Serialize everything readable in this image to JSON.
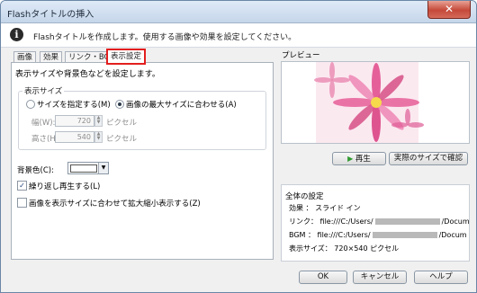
{
  "window": {
    "title": "Flashタイトルの挿入",
    "close_glyph": "✕"
  },
  "info": {
    "text": "Flashタイトルを作成します。使用する画像や効果を設定してください。",
    "icon": "info-icon"
  },
  "tabs": [
    {
      "label": "画像"
    },
    {
      "label": "効果"
    },
    {
      "label": "リンク・BGM"
    },
    {
      "label": "表示設定"
    }
  ],
  "panel": {
    "description": "表示サイズや背景色などを設定します。",
    "size_group": {
      "label": "表示サイズ",
      "radio_specify": "サイズを指定する(M)",
      "radio_max": "画像の最大サイズに合わせる(A)",
      "width_label": "幅(W):",
      "width_value": "720",
      "height_label": "高さ(H):",
      "height_value": "540",
      "unit": "ピクセル"
    },
    "bg_color_label": "背景色(C):",
    "bg_color_value": "#ffffff",
    "repeat_label": "繰り返し再生する(L)",
    "repeat_checked": "✓",
    "fit_label": "画像を表示サイズに合わせて拡大縮小表示する(Z)"
  },
  "preview": {
    "label": "プレビュー",
    "play_button": "再生",
    "actual_size_button": "実際のサイズで確認"
  },
  "summary": {
    "label": "全体の設定",
    "effect": "効果 ： スライド イン",
    "link_prefix": "リンク： file:///C:/Users/",
    "link_suffix": "/Docum",
    "bgm_prefix": "BGM ： file:///C:/Users/",
    "bgm_suffix": "/Docum",
    "display_size": "表示サイズ： 720×540 ピクセル"
  },
  "buttons": {
    "ok": "OK",
    "cancel": "キャンセル",
    "help": "ヘルプ"
  }
}
